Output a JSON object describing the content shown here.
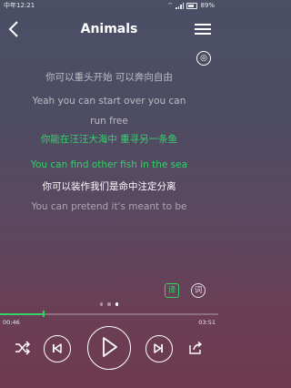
{
  "status": {
    "carrier": "中年",
    "time": "12:21",
    "battery": "89%"
  },
  "header": {
    "title": "Animals"
  },
  "mode_icon_glyph": "◎",
  "lyrics": [
    {
      "text": "你可以重头开始 可以奔向自由",
      "state": "dim"
    },
    {
      "text": "Yeah you can start over you can",
      "state": "dim"
    },
    {
      "text": "run free",
      "state": "dim"
    },
    {
      "text": "你能在汪汪大海中 重寻另一条鱼",
      "state": "active"
    },
    {
      "text": "You can find other fish in the sea",
      "state": "active"
    },
    {
      "text": "你可以装作我们是命中注定分离",
      "state": "bright"
    },
    {
      "text": "You can pretend it's meant to be",
      "state": "faint"
    }
  ],
  "buttons": {
    "translate": "译",
    "word": "词"
  },
  "page_indicator": {
    "count": 3,
    "active": 2
  },
  "playback": {
    "current_time": "00:46",
    "total_time": "03:51",
    "progress": 0.2
  },
  "colors": {
    "accent": "#34d06a"
  }
}
